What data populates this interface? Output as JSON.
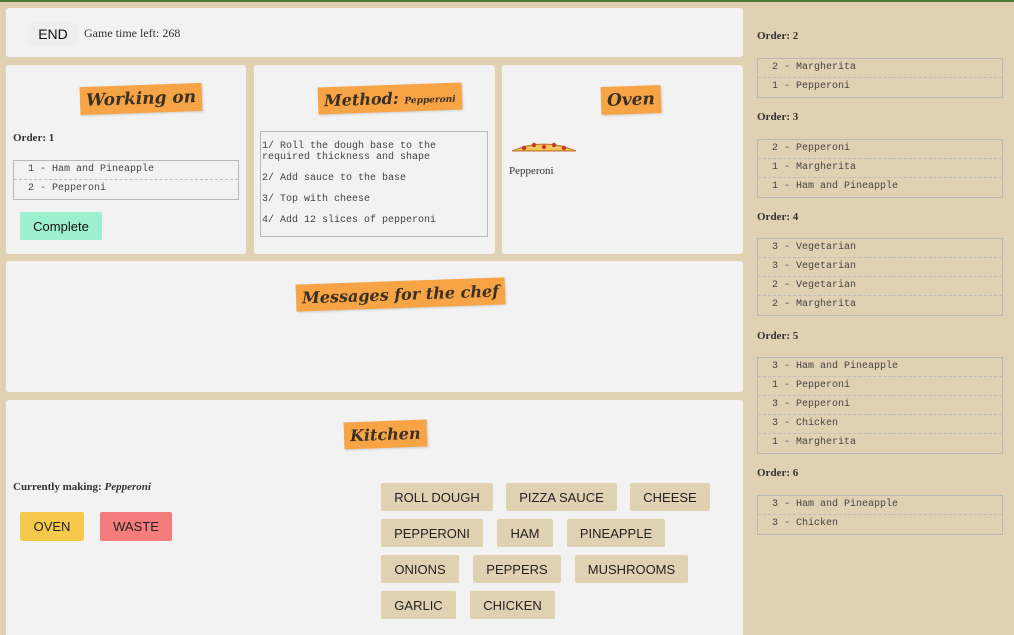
{
  "header": {
    "end_label": "END",
    "time_label": "Game time left:",
    "time_value": "268"
  },
  "working": {
    "title": "Working on",
    "order_label": "Order: 1",
    "items": [
      "1 - Ham and Pineapple",
      "2 - Pepperoni"
    ],
    "complete_label": "Complete"
  },
  "method": {
    "title": "Method:",
    "pizza": "Pepperoni",
    "steps": [
      "1/ Roll the dough base to the required thickness and shape",
      "2/ Add sauce to the base",
      "3/ Top with cheese",
      "4/ Add 12 slices of pepperoni"
    ]
  },
  "oven": {
    "title": "Oven",
    "item": "Pepperoni",
    "icon": "pizza-icon"
  },
  "messages": {
    "title": "Messages for the chef"
  },
  "kitchen": {
    "title": "Kitchen",
    "currently_label": "Currently making:",
    "currently_value": "Pepperoni",
    "oven_label": "OVEN",
    "waste_label": "WASTE",
    "ingredients": [
      "ROLL DOUGH",
      "PIZZA SAUCE",
      "CHEESE",
      "PEPPERONI",
      "HAM",
      "PINEAPPLE",
      "ONIONS",
      "PEPPERS",
      "MUSHROOMS",
      "GARLIC",
      "CHICKEN"
    ]
  },
  "queue": [
    {
      "label": "Order: 2",
      "items": [
        "2 - Margherita",
        "1 - Pepperoni"
      ]
    },
    {
      "label": "Order: 3",
      "items": [
        "2 - Pepperoni",
        "1 - Margherita",
        "1 - Ham and Pineapple"
      ]
    },
    {
      "label": "Order: 4",
      "items": [
        "3 - Vegetarian",
        "3 - Vegetarian",
        "2 - Vegetarian",
        "2 - Margherita"
      ]
    },
    {
      "label": "Order: 5",
      "items": [
        "3 - Ham and Pineapple",
        "1 - Pepperoni",
        "3 - Pepperoni",
        "3 - Chicken",
        "1 - Margherita"
      ]
    },
    {
      "label": "Order: 6",
      "items": [
        "3 - Ham and Pineapple",
        "3 - Chicken"
      ]
    }
  ],
  "colors": {
    "background": "#e1d1b3",
    "panel": "#f2f2f2",
    "sticker": "#f7a447",
    "complete": "#9cf0cf",
    "oven": "#f5ca4c",
    "waste": "#f47c7c",
    "ingredient": "#e1d1b3"
  }
}
